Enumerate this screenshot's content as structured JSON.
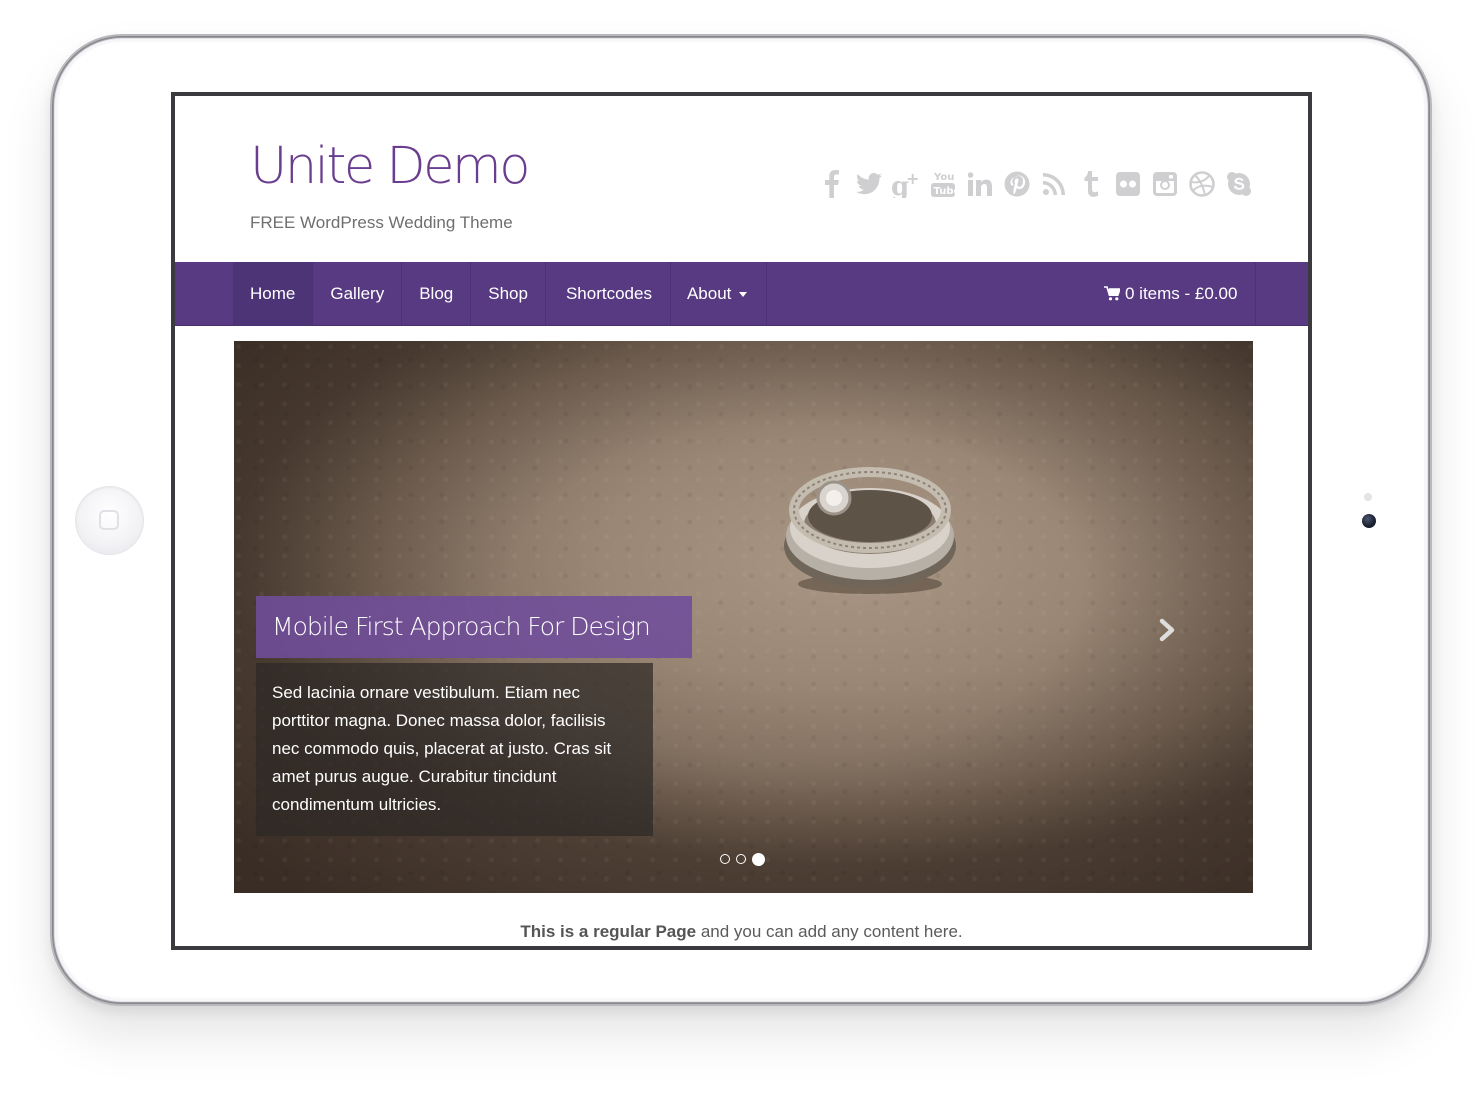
{
  "site": {
    "title": "Unite Demo",
    "tagline": "FREE WordPress Wedding Theme"
  },
  "social": [
    {
      "icon": "facebook-icon",
      "label": "f"
    },
    {
      "icon": "twitter-icon"
    },
    {
      "icon": "google-plus-icon",
      "label": "g+"
    },
    {
      "icon": "youtube-icon",
      "label": "You Tube"
    },
    {
      "icon": "linkedin-icon",
      "label": "in"
    },
    {
      "icon": "pinterest-icon"
    },
    {
      "icon": "rss-icon"
    },
    {
      "icon": "tumblr-icon",
      "label": "t"
    },
    {
      "icon": "flickr-icon"
    },
    {
      "icon": "instagram-icon"
    },
    {
      "icon": "dribbble-icon"
    },
    {
      "icon": "skype-icon"
    }
  ],
  "nav": {
    "items": [
      {
        "label": "Home",
        "active": true
      },
      {
        "label": "Gallery"
      },
      {
        "label": "Blog"
      },
      {
        "label": "Shop"
      },
      {
        "label": "Shortcodes"
      },
      {
        "label": "About",
        "dropdown": true
      }
    ],
    "cart_label": "0 items - £0.00"
  },
  "slider": {
    "caption_title": "Mobile First Approach For Design",
    "caption_body": "Sed lacinia ornare vestibulum. Etiam nec porttitor magna. Donec massa dolor, facilisis nec commodo quis, placerat at justo. Cras sit amet purus augue. Curabitur tincidunt condimentum ultricies.",
    "slide_count": 3,
    "active_slide": 3
  },
  "content": {
    "bold_text": "This is a regular Page",
    "rest_text": " and you can add any content here."
  },
  "colors": {
    "brand_purple": "#573a81",
    "title_purple": "#6a3e8e",
    "caption_purple": "#6f4d9b"
  }
}
